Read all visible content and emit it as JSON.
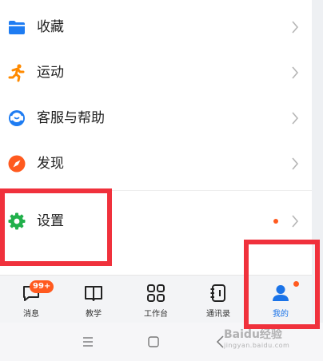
{
  "menu": {
    "items": [
      {
        "label": "收藏",
        "icon": "folder-icon",
        "color": "#1e7cf2"
      },
      {
        "label": "运动",
        "icon": "running-person-icon",
        "color": "#ff8a00"
      },
      {
        "label": "客服与帮助",
        "icon": "headset-icon",
        "color": "#1e7cf2"
      },
      {
        "label": "发现",
        "icon": "compass-icon",
        "color": "#ff5a1f"
      },
      {
        "label": "设置",
        "icon": "gear-icon",
        "color": "#21b04b",
        "has_dot": true,
        "dot_color": "#ff5a1f"
      }
    ]
  },
  "tabbar": {
    "tabs": [
      {
        "label": "消息",
        "icon": "chat-bubble-icon",
        "badge": "99+"
      },
      {
        "label": "教学",
        "icon": "book-icon"
      },
      {
        "label": "工作台",
        "icon": "grid-icon"
      },
      {
        "label": "通讯录",
        "icon": "contacts-icon"
      },
      {
        "label": "我的",
        "icon": "person-icon",
        "active": true,
        "dot_color": "#ff5a1f"
      }
    ],
    "active_color": "#1a73e8"
  },
  "system_nav": {
    "buttons": [
      "menu-icon",
      "home-icon",
      "back-icon"
    ]
  },
  "watermark": {
    "text": "Baidu经验",
    "sub": "jingyan.baidu.com"
  },
  "highlight_color": "#f0313c"
}
